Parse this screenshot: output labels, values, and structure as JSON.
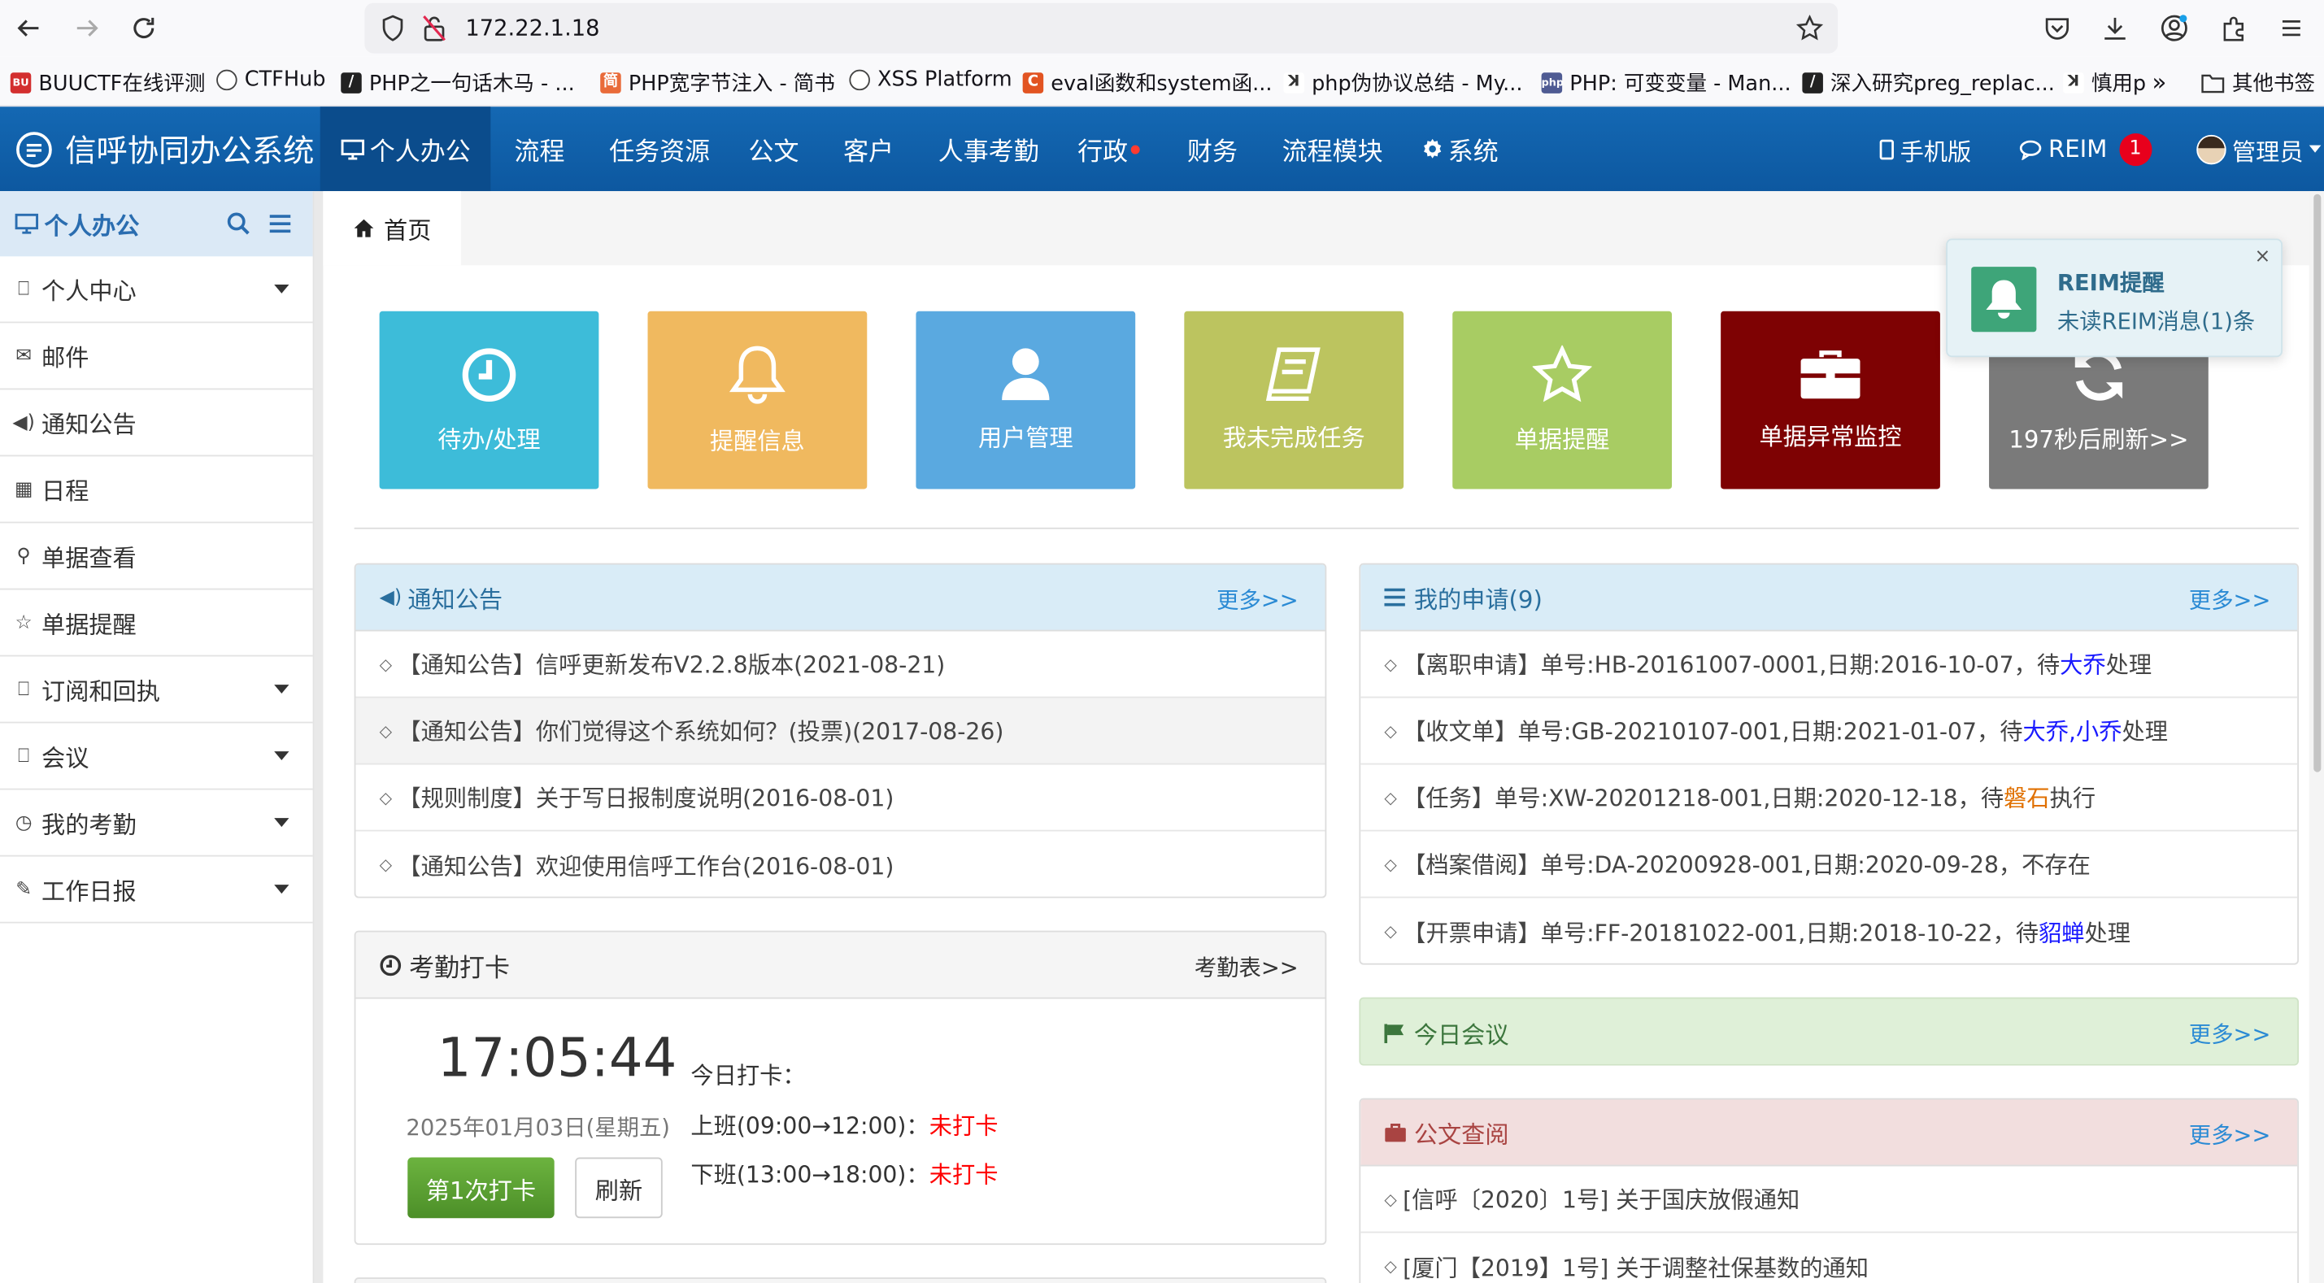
{
  "browser": {
    "url": "172.22.1.18",
    "bookmarks": [
      "BUUCTF在线评测",
      "CTFHub",
      "PHP之一句话木马 - ...",
      "PHP宽字节注入 - 简书",
      "XSS Platform",
      "eval函数和system函...",
      "php伪协议总结 - My...",
      "PHP: 可变变量 - Man...",
      "深入研究preg_replac...",
      "慎用p",
      "其他书签"
    ],
    "bookmark_colors": [
      "#d32f2f",
      "#444444",
      "#222222",
      "#e96b3a",
      "#444444",
      "#e25422",
      "#333333",
      "#4f5b93",
      "#222222",
      "#333333",
      "#333333"
    ]
  },
  "app": {
    "title": "信呼协同办公系统",
    "nav": [
      "个人办公",
      "流程",
      "任务资源",
      "公文",
      "客户",
      "人事考勤",
      "行政",
      "财务",
      "流程模块",
      "系统"
    ],
    "mobile": "手机版",
    "reim": "REIM",
    "reim_badge": "1",
    "user": "管理员"
  },
  "sidebar": {
    "title": "个人办公",
    "items": [
      {
        "label": "个人中心",
        "icon": "bookmark-icon",
        "caret": true
      },
      {
        "label": "邮件",
        "icon": "envelope-icon",
        "caret": false
      },
      {
        "label": "通知公告",
        "icon": "volume-icon",
        "caret": false
      },
      {
        "label": "日程",
        "icon": "calendar-icon",
        "caret": false
      },
      {
        "label": "单据查看",
        "icon": "search-icon",
        "caret": false
      },
      {
        "label": "单据提醒",
        "icon": "star-icon",
        "caret": false
      },
      {
        "label": "订阅和回执",
        "icon": "bookmark-icon",
        "caret": true
      },
      {
        "label": "会议",
        "icon": "bookmark-icon",
        "caret": true
      },
      {
        "label": "我的考勤",
        "icon": "clock-icon",
        "caret": true
      },
      {
        "label": "工作日报",
        "icon": "edit-icon",
        "caret": true
      }
    ]
  },
  "tab": {
    "home": "首页"
  },
  "tiles": [
    {
      "label": "待办/处理",
      "color": "#3dbcd9",
      "icon": "clock-icon"
    },
    {
      "label": "提醒信息",
      "color": "#f0b95f",
      "icon": "bell-icon"
    },
    {
      "label": "用户管理",
      "color": "#5aa9e0",
      "icon": "user-icon"
    },
    {
      "label": "我未完成任务",
      "color": "#bcc45f",
      "icon": "book-icon"
    },
    {
      "label": "单据提醒",
      "color": "#a8cc63",
      "icon": "star-icon"
    },
    {
      "label": "单据异常监控",
      "color": "#7e0203",
      "icon": "briefcase-icon"
    },
    {
      "label": "197秒后刷新>>",
      "color": "#7a7a7a",
      "icon": "refresh-icon"
    }
  ],
  "notices": {
    "title": "通知公告",
    "more": "更多>>",
    "rows": [
      "【通知公告】信呼更新发布V2.2.8版本(2021-08-21)",
      "【通知公告】你们觉得这个系统如何？(投票)(2017-08-26)",
      "【规则制度】关于写日报制度说明(2016-08-01)",
      "【通知公告】欢迎使用信呼工作台(2016-08-01)"
    ]
  },
  "applications": {
    "title": "我的申请(9)",
    "more": "更多>>",
    "rows": [
      {
        "text": "【离职申请】单号:HB-20161007-0001,日期:2016-10-07，待",
        "name": "大乔",
        "tail": "处理",
        "name_class": "blue-name"
      },
      {
        "text": "【收文单】单号:GB-20210107-001,日期:2021-01-07，待",
        "name": "大乔,小乔",
        "tail": "处理",
        "name_class": "blue-name"
      },
      {
        "text": "【任务】单号:XW-20201218-001,日期:2020-12-18，待",
        "name": "磐石",
        "tail": "执行",
        "name_class": "orange-name"
      },
      {
        "text": "【档案借阅】单号:DA-20200928-001,日期:2020-09-28，不存在",
        "name": "",
        "tail": "",
        "name_class": ""
      },
      {
        "text": "【开票申请】单号:FF-20181022-001,日期:2018-10-22，待",
        "name": "貂蝉",
        "tail": "处理",
        "name_class": "blue-name"
      }
    ]
  },
  "attendance": {
    "title": "考勤打卡",
    "link": "考勤表>>",
    "time": "17:05:44",
    "date": "2025年01月03日(星期五)",
    "punch_button": "第1次打卡",
    "refresh_button": "刷新",
    "today_label": "今日打卡：",
    "on_duty": "上班(09:00→12:00)：",
    "off_duty": "下班(13:00→18:00)：",
    "status_on": "未打卡",
    "status_off": "未打卡"
  },
  "meeting": {
    "title": "今日会议",
    "more": "更多>>"
  },
  "documents": {
    "title": "公文查阅",
    "more": "更多>>",
    "rows": [
      "[信呼〔2020〕1号] 关于国庆放假通知",
      "[厦门【2019】1号] 关于调整社保基数的通知"
    ]
  },
  "toast": {
    "title": "REIM提醒",
    "message": "未读REIM消息(1)条",
    "close": "×"
  }
}
